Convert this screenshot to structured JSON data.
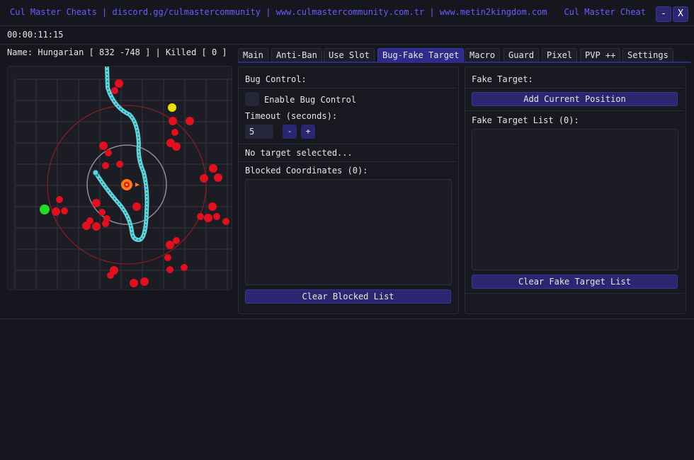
{
  "window": {
    "title_left": "Cul Master Cheats | discord.gg/culmastercommunity | www.culmastercommunity.com.tr | www.metin2kingdom.com",
    "title_right": "Cul Master Cheat",
    "minimize_label": "-",
    "close_label": "X"
  },
  "status": {
    "timer": "00:00:11:15",
    "name_line": "Name: Hungarian [ 832 -748 ] | Killed [ 0 ]"
  },
  "tabs": [
    {
      "label": "Main"
    },
    {
      "label": "Anti-Ban"
    },
    {
      "label": "Use Slot"
    },
    {
      "label": "Bug-Fake Target",
      "active": true
    },
    {
      "label": "Macro"
    },
    {
      "label": "Guard"
    },
    {
      "label": "Pixel"
    },
    {
      "label": "PVP ++"
    },
    {
      "label": "Settings"
    }
  ],
  "bug_panel": {
    "heading": "Bug Control:",
    "enable_label": "Enable Bug Control",
    "timeout_label": "Timeout (seconds):",
    "timeout_value": "5",
    "minus_label": "-",
    "plus_label": "+",
    "target_status": "No target selected...",
    "blocked_label": "Blocked Coordinates (0):",
    "clear_blocked_label": "Clear Blocked List"
  },
  "fake_panel": {
    "heading": "Fake Target:",
    "add_position_label": "Add Current Position",
    "list_label": "Fake Target List (0):",
    "clear_list_label": "Clear Fake Target List"
  },
  "colors": {
    "accent": "#6b5cff",
    "button": "#2a2670",
    "tab_active": "#2f2b8a",
    "path": "#5fd3dc",
    "enemy": "#e0101e",
    "player": "#ff7a1a",
    "ally": "#22dd22",
    "item": "#e8e000"
  }
}
